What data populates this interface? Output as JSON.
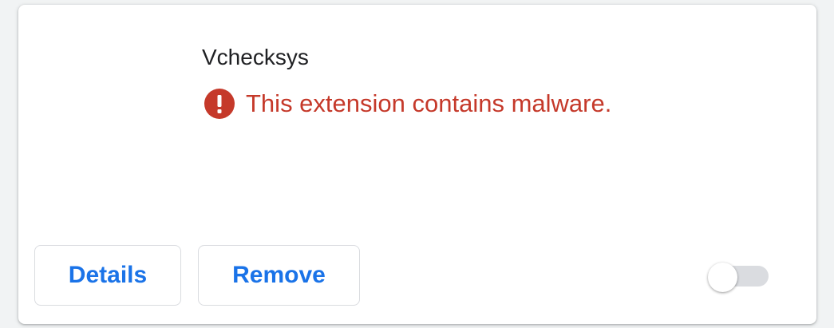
{
  "extension": {
    "name": "Vchecksys",
    "warning": {
      "icon": "error-icon",
      "text": "This extension contains malware.",
      "color": "#c5392a"
    },
    "enabled": false
  },
  "actions": {
    "details_label": "Details",
    "remove_label": "Remove",
    "accent_color": "#1a73e8"
  }
}
